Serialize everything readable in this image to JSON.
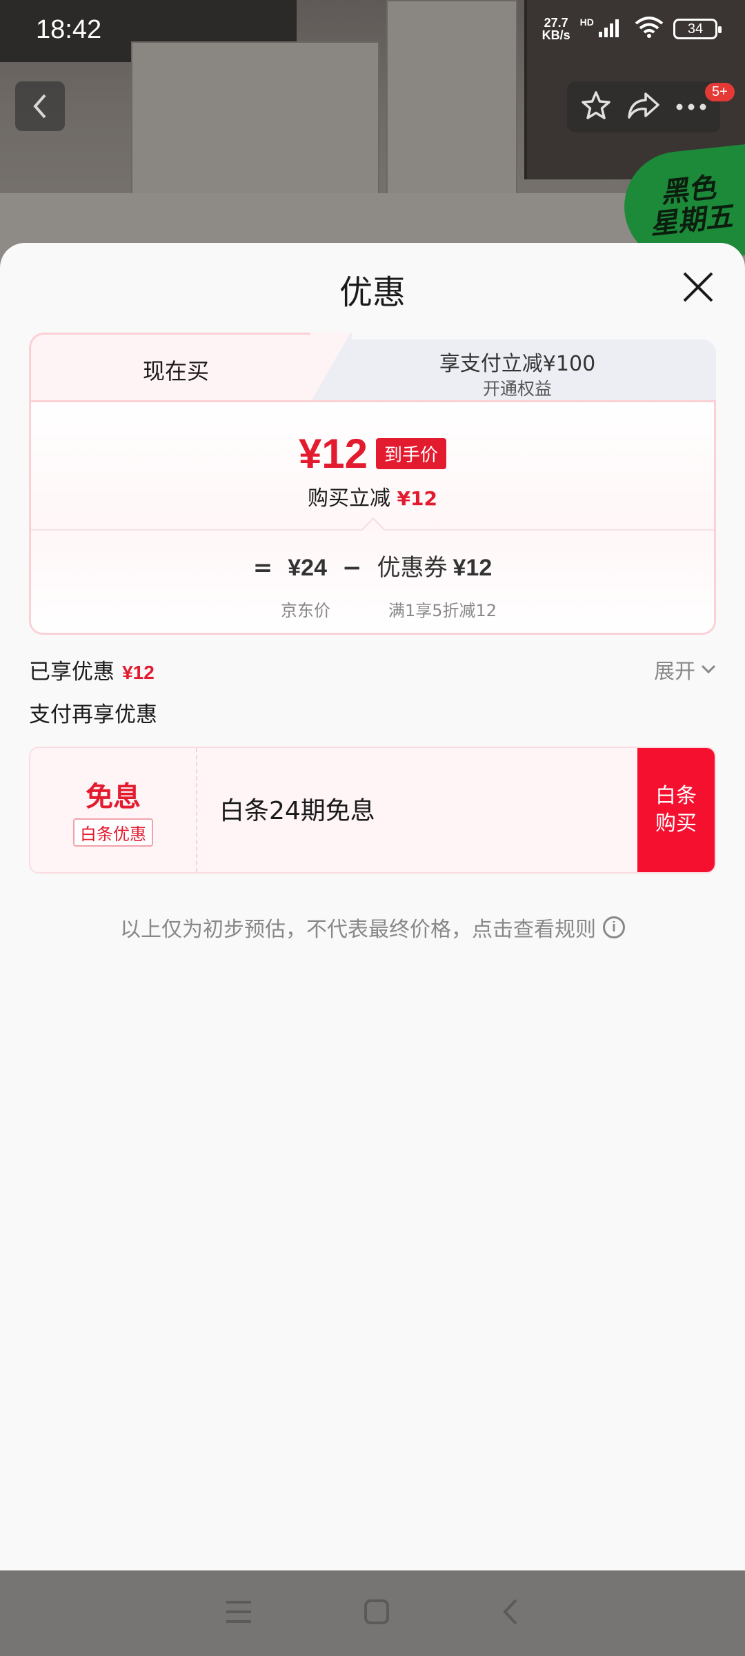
{
  "status_bar": {
    "time": "18:42",
    "net_speed_value": "27.7",
    "net_speed_unit": "KB/s",
    "hd_label": "HD",
    "battery": "34"
  },
  "header": {
    "badge": "5+",
    "promo_sticker": "黑色\n星期五"
  },
  "sheet": {
    "title": "优惠",
    "tabs": {
      "now_label": "现在买",
      "other_title": "享支付立减¥100",
      "other_sub": "开通权益"
    },
    "price": {
      "final_amount": "¥12",
      "final_tag": "到手价",
      "reduce_label": "购买立减",
      "reduce_amount": "¥12"
    },
    "calc": {
      "equals": "=",
      "jd_price": "¥24",
      "minus": "−",
      "coupon_label": "优惠券",
      "coupon_value": "¥12",
      "jd_price_label": "京东价",
      "coupon_rule": "满1享5折减12"
    },
    "enjoyed": {
      "label": "已享优惠",
      "amount": "¥12",
      "expand_label": "展开"
    },
    "pay_more_label": "支付再享优惠",
    "baitiao": {
      "main": "免息",
      "tag": "白条优惠",
      "text": "白条24期免息",
      "button": "白条\n购买"
    },
    "disclaimer": "以上仅为初步预估，不代表最终价格，点击查看规则"
  },
  "colors": {
    "accent_red": "#e31b2f",
    "button_red": "#f5102f"
  },
  "icons": [
    "back-arrow-icon",
    "star-icon",
    "share-icon",
    "more-icon",
    "close-icon",
    "chevron-down-icon",
    "info-icon",
    "menu-icon",
    "home-icon",
    "back-icon"
  ]
}
